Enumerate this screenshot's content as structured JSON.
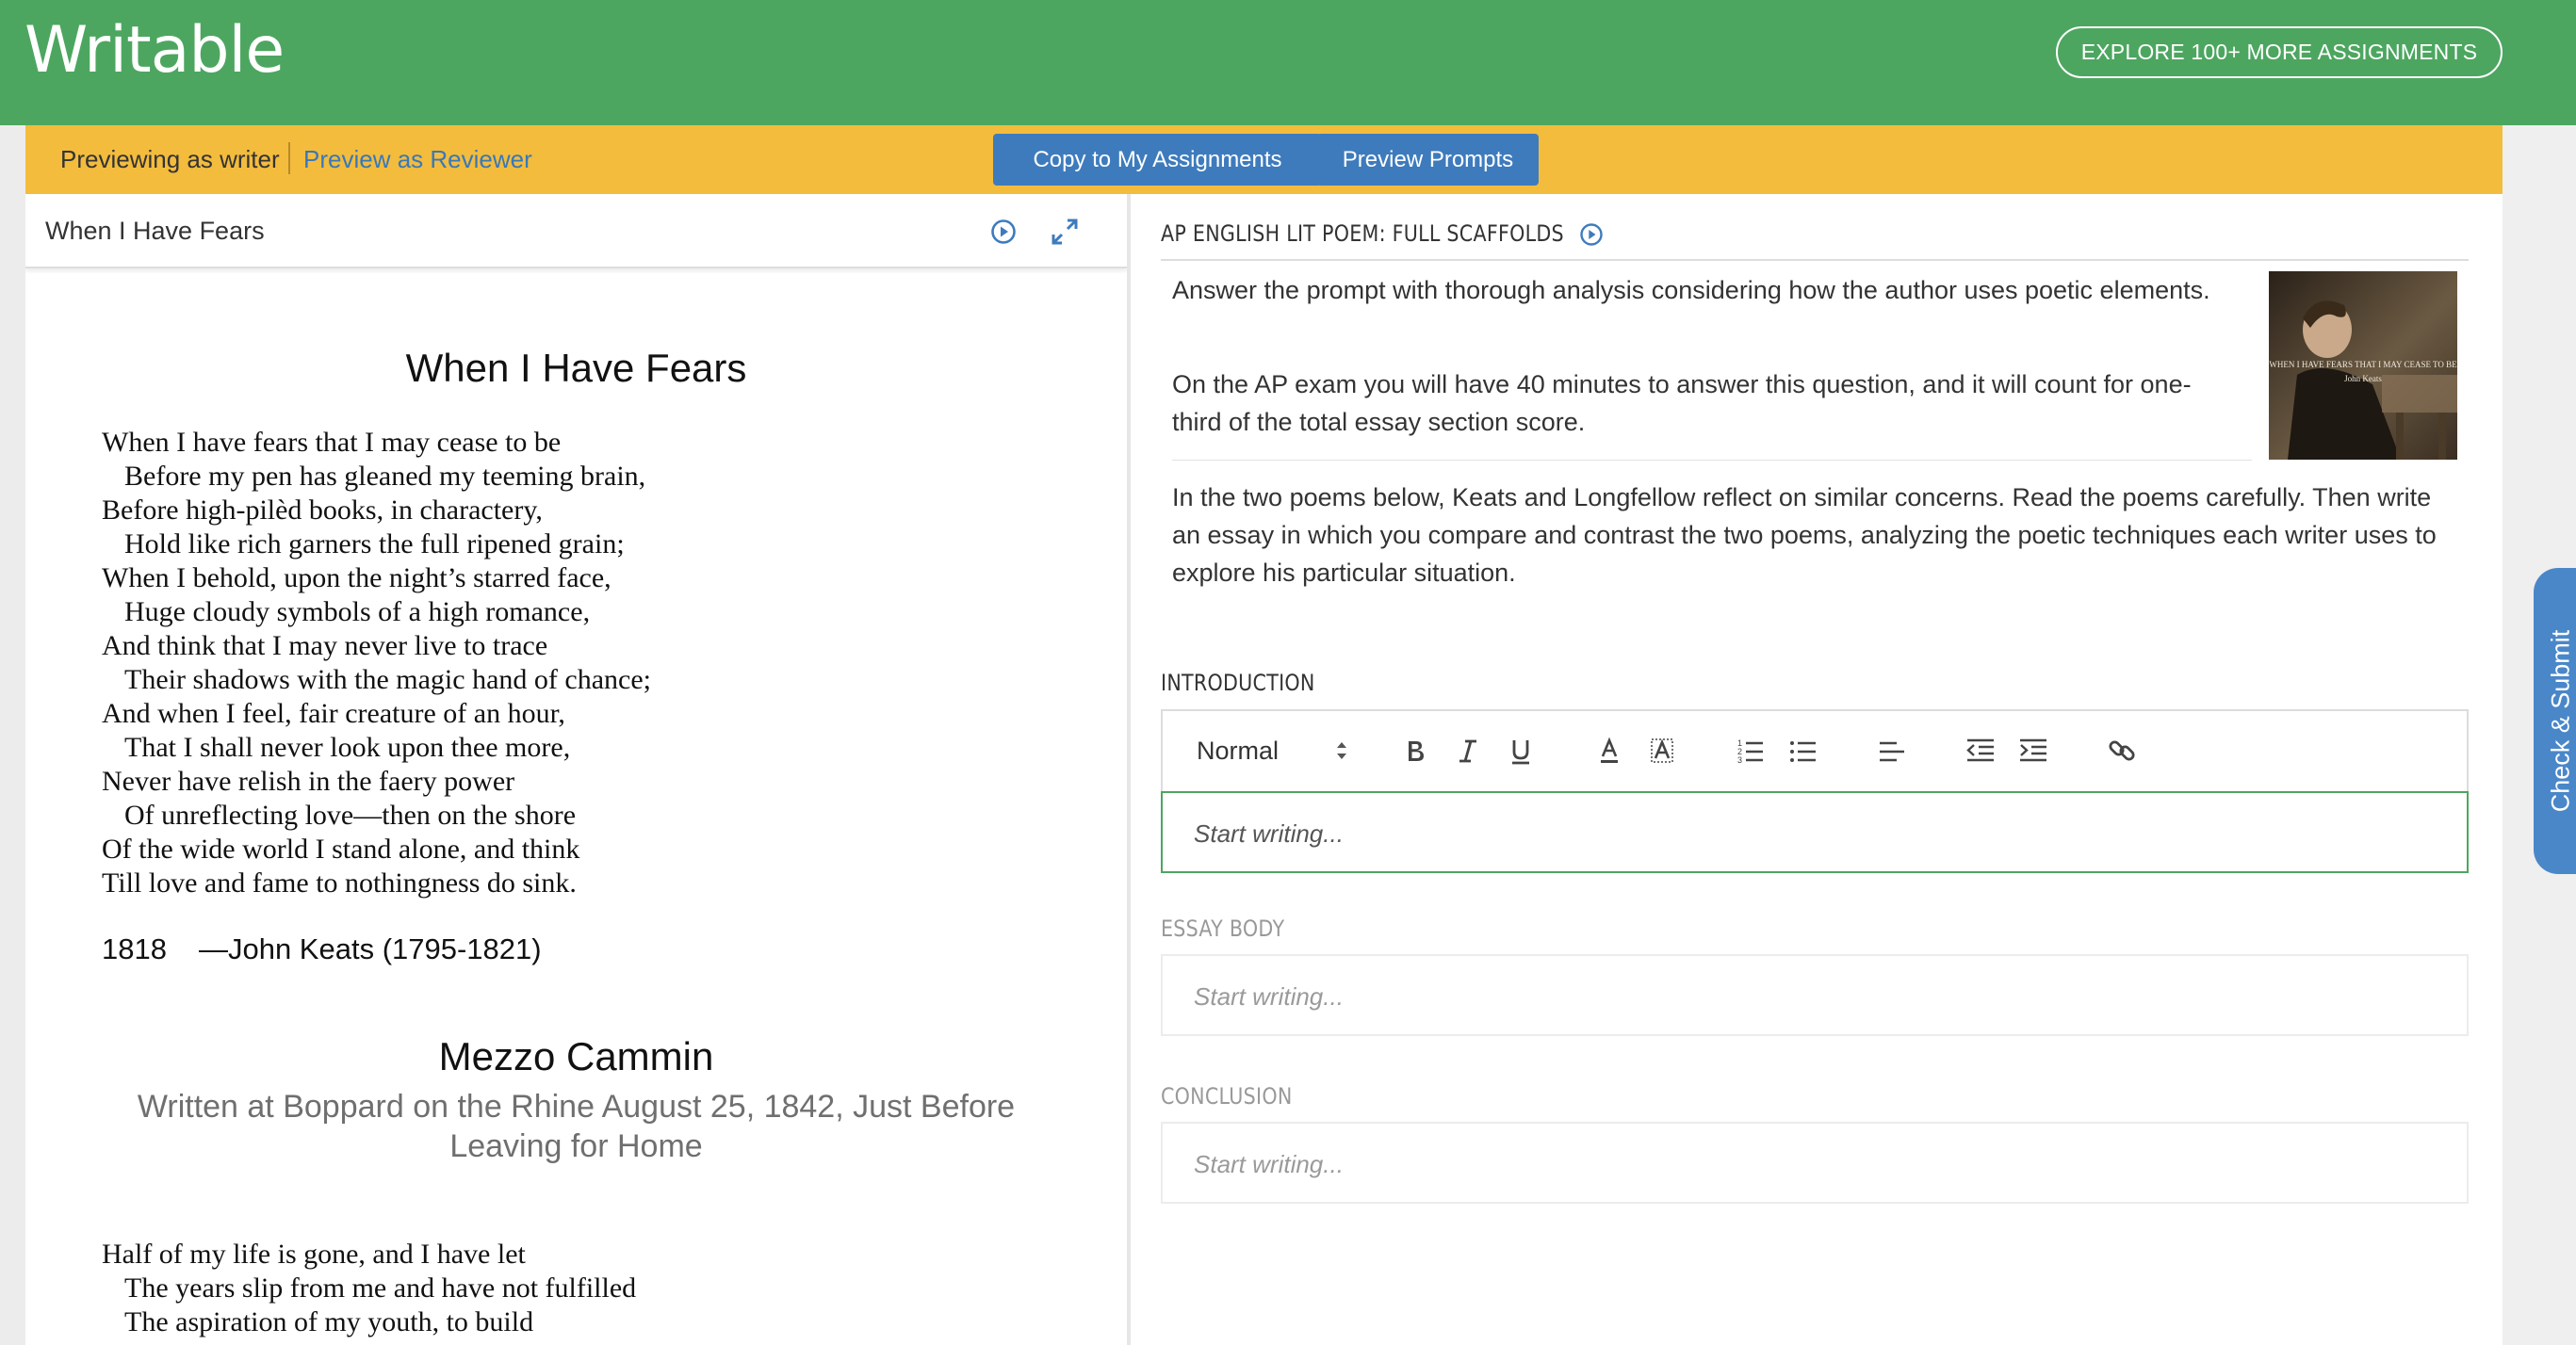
{
  "header": {
    "logo": "Writable",
    "explore_button": "EXPLORE 100+ MORE ASSIGNMENTS",
    "brand_color": "#4da660"
  },
  "preview_bar": {
    "writer_label": "Previewing as writer",
    "reviewer_link": "Preview as Reviewer",
    "copy_button": "Copy to My Assignments",
    "prompts_button": "Preview Prompts"
  },
  "side_tab": {
    "label": "Check & Submit"
  },
  "left_panel": {
    "title": "When I Have Fears",
    "poem1": {
      "title": "When I Have Fears",
      "lines": [
        "When I have fears that I may cease to be",
        "Before my pen has gleaned my teeming brain,",
        "Before high-pilèd books, in charactery,",
        "Hold like rich garners the full ripened grain;",
        "When I behold, upon the night’s starred face,",
        "Huge cloudy symbols of a high romance,",
        "And think that I may never live to trace",
        "Their shadows with the magic hand of chance;",
        "And when I feel, fair creature of an hour,",
        "That I shall never look upon thee more,",
        "Never have relish in the faery power",
        "Of unreflecting love—then on the shore",
        "Of the wide world I stand alone, and think",
        "Till love and fame to nothingness do sink."
      ],
      "year": "1818",
      "author": "—John Keats (1795-1821)"
    },
    "poem2": {
      "title": "Mezzo Cammin",
      "subtitle": "Written at Boppard on the Rhine August 25, 1842, Just Before Leaving for Home",
      "lines": [
        "Half of my life is gone, and I have let",
        "The years slip from me and have not fulfilled",
        "The aspiration of my youth, to build"
      ]
    }
  },
  "right_panel": {
    "heading": "AP ENGLISH LIT POEM: FULL SCAFFOLDS",
    "prompt_1": "Answer the prompt with thorough analysis considering how the author uses poetic elements.",
    "prompt_2": "On the AP exam you will have 40 minutes to answer this question, and it will count for one-third of the total essay section score.",
    "prompt_3": "In the two poems below, Keats and Longfellow reflect on similar concerns. Read the poems carefully. Then write an essay in which you compare and contrast the two poems, analyzing the poetic techniques each writer uses to explore his particular situation.",
    "thumbnail": {
      "caption": "WHEN I HAVE FEARS THAT I MAY CEASE TO BE",
      "author": "John Keats"
    },
    "sections": {
      "introduction": "INTRODUCTION",
      "essay_body": "ESSAY BODY",
      "conclusion": "CONCLUSION"
    },
    "toolbar": {
      "format_select": "Normal"
    },
    "editor_placeholder": "Start writing..."
  }
}
